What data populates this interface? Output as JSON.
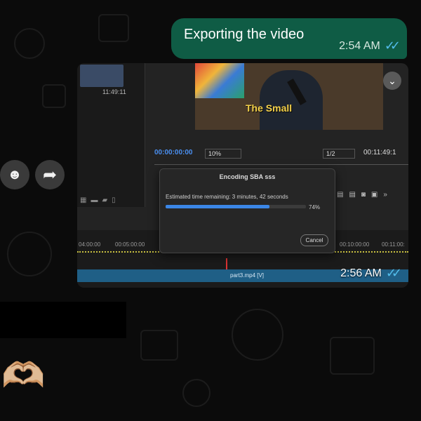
{
  "messages": {
    "sent_text": {
      "text": "Exporting the video",
      "time": "2:54 AM",
      "ticks": "✓✓"
    },
    "image_message": {
      "time": "2:56 AM",
      "ticks": "✓✓",
      "screenshot": {
        "left_panel_timecode": "11:49:11",
        "video_caption": "The Small",
        "program_timecode": "00:00:00:00",
        "zoom": "10%",
        "resolution": "1/2",
        "duration_timecode": "00:11:49:1",
        "timeline_ticks": [
          "04:00:00",
          "00:05:00:00",
          "00:10:00:00",
          "00:11:00:"
        ],
        "clip_label": "part3.mp4 [V]",
        "dialog": {
          "title": "Encoding SBA sss",
          "estimated": "Estimated time remaining: 3 minutes, 42 seconds",
          "progress": 0.74,
          "progress_label": "74%",
          "cancel": "Cancel"
        }
      }
    },
    "reaction_emoji": "🫶🏼"
  },
  "actions": {
    "emoji_icon": "☻",
    "share_icon": "➦",
    "download_icon": "⌄"
  },
  "colors": {
    "sent_bubble": "#0f5c45",
    "read_ticks": "#53bdeb",
    "progress_fill": "#3b86e6"
  }
}
